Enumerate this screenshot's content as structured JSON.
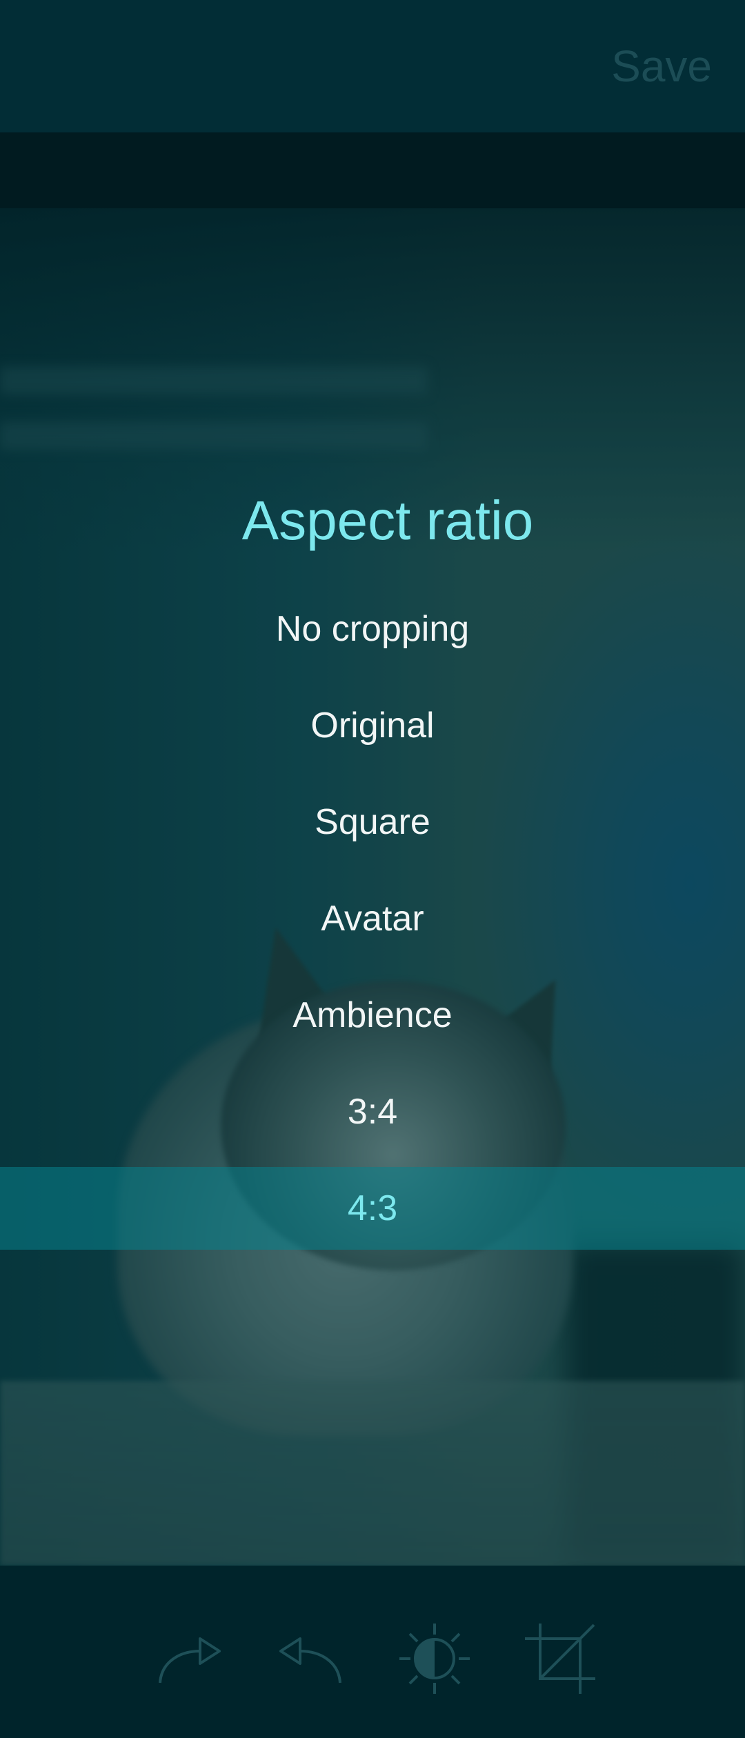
{
  "header": {
    "save_label": "Save"
  },
  "menu": {
    "title": "Aspect ratio",
    "items": [
      {
        "label": "No cropping",
        "selected": false
      },
      {
        "label": "Original",
        "selected": false
      },
      {
        "label": "Square",
        "selected": false
      },
      {
        "label": "Avatar",
        "selected": false
      },
      {
        "label": "Ambience",
        "selected": false
      },
      {
        "label": "3:4",
        "selected": false
      },
      {
        "label": "4:3",
        "selected": true
      }
    ]
  },
  "toolbar": {
    "icons": [
      "redo-icon",
      "undo-icon",
      "brightness-icon",
      "crop-icon"
    ]
  },
  "colors": {
    "accent": "#7de8ee",
    "selection_band": "#08828c",
    "background": "#00242b",
    "header": "#022d36",
    "disabled_text": "#1c4d56",
    "icon_muted": "#1e5058"
  }
}
